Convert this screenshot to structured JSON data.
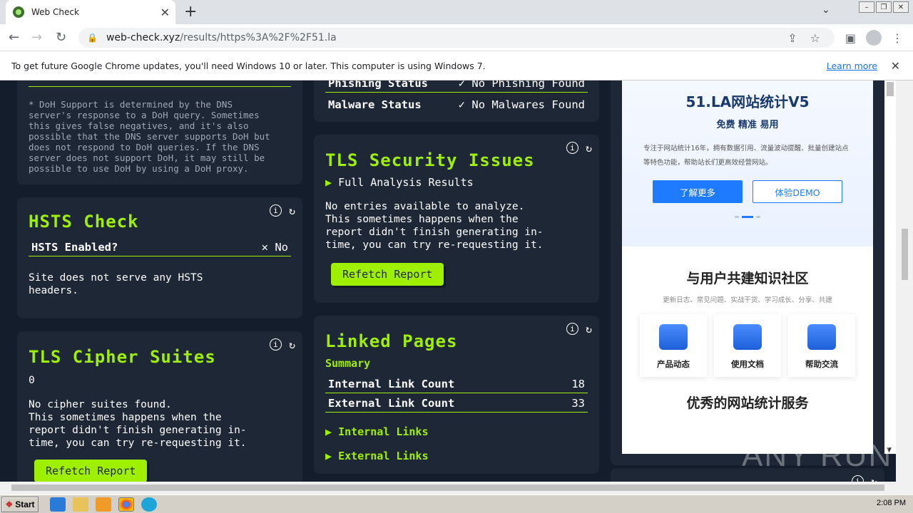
{
  "browser": {
    "tab_title": "Web Check",
    "url_host": "web-check.xyz",
    "url_path": "/results/https%3A%2F%2F51.la"
  },
  "infobar": {
    "message": "To get future Google Chrome updates, you'll need Windows 10 or later. This computer is using Windows 7.",
    "learn_more": "Learn more"
  },
  "doh": {
    "note": "* DoH Support is determined by the DNS\nserver's response to a DoH query. Sometimes\nthis gives false negatives, and it's also\npossible that the DNS server supports DoH but\ndoes not respond to DoH queries. If the DNS\nserver does not support DoH, it may still be\npossible to use DoH by using a DoH proxy."
  },
  "hsts": {
    "title": "HSTS Check",
    "label": "HSTS Enabled?",
    "value": "No",
    "message": "Site does not serve any HSTS\nheaders."
  },
  "cipher": {
    "title": "TLS Cipher Suites",
    "count": "0",
    "message": "No cipher suites found.\nThis sometimes happens when the\nreport didn't finish generating in-\ntime, you can try re-requesting it.",
    "button": "Refetch Report"
  },
  "phishing": {
    "label": "Phishing Status",
    "value": "No Phishing Found",
    "malware_label": "Malware Status",
    "malware_value": "No Malwares Found"
  },
  "tls_issues": {
    "title": "TLS Security Issues",
    "full": "Full Analysis Results",
    "message": "No entries available to analyze.\nThis sometimes happens when the\nreport didn't finish generating in-\ntime, you can try re-requesting it.",
    "button": "Refetch Report"
  },
  "linked": {
    "title": "Linked Pages",
    "summary": "Summary",
    "internal_label": "Internal Link Count",
    "internal_value": "18",
    "external_label": "External Link Count",
    "external_value": "33",
    "internal_links": "Internal Links",
    "external_links": "External Links"
  },
  "ad": {
    "title": "51.LA网站统计V5",
    "sub": "免费 精准 易用",
    "desc": "专注于网站统计16年，拥有数据引用、流量波动提醒、批量创建站点等特色功能，帮助站长们更高效经营网站。",
    "btn1": "了解更多",
    "btn2": "体验DEMO",
    "h": "与用户共建知识社区",
    "h2": "更新日志、常见问题、实战干货、学习成长、分享、共建",
    "cards": [
      "产品动态",
      "使用文档",
      "帮助交流"
    ],
    "h3": "优秀的网站统计服务"
  },
  "taskbar": {
    "start": "Start",
    "time": "2:08 PM"
  },
  "watermark": "ANY RUN"
}
